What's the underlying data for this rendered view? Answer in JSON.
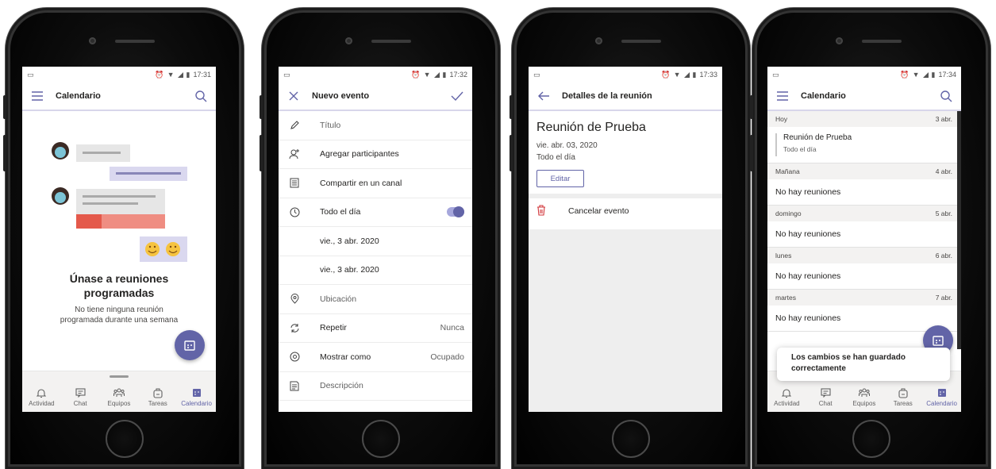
{
  "screens": [
    {
      "time": "17:31",
      "header": {
        "title": "Calendario"
      },
      "empty_state": {
        "title": "Únase a reuniones programadas",
        "subtitle": "No tiene ninguna reunión programada durante una semana"
      }
    },
    {
      "time": "17:32",
      "header": {
        "title": "Nuevo evento"
      },
      "form": [
        {
          "icon": "pencil-icon",
          "label": "Título",
          "value": "",
          "placeholder": true
        },
        {
          "icon": "add-person-icon",
          "label": "Agregar participantes",
          "value": ""
        },
        {
          "icon": "channel-icon",
          "label": "Compartir en un canal",
          "value": ""
        },
        {
          "icon": "clock-icon",
          "label": "Todo el día",
          "value": "",
          "toggle": true
        },
        {
          "icon": "",
          "label": "vie., 3 abr. 2020",
          "value": ""
        },
        {
          "icon": "",
          "label": "vie., 3 abr. 2020",
          "value": ""
        },
        {
          "icon": "location-icon",
          "label": "Ubicación",
          "value": "",
          "placeholder": true
        },
        {
          "icon": "repeat-icon",
          "label": "Repetir",
          "value": "Nunca"
        },
        {
          "icon": "eye-icon",
          "label": "Mostrar como",
          "value": "Ocupado"
        },
        {
          "icon": "description-icon",
          "label": "Descripción",
          "value": "",
          "placeholder": true
        }
      ]
    },
    {
      "time": "17:33",
      "header": {
        "title": "Detalles de la reunión"
      },
      "meeting": {
        "title": "Reunión de Prueba",
        "date": "vie. abr. 03, 2020",
        "duration": "Todo el día",
        "edit_label": "Editar",
        "cancel_label": "Cancelar evento"
      }
    },
    {
      "time": "17:34",
      "header": {
        "title": "Calendario"
      },
      "agenda": [
        {
          "day": "Hoy",
          "date": "3 abr.",
          "meeting": {
            "title": "Reunión de Prueba",
            "sub": "Todo el día"
          }
        },
        {
          "day": "Mañana",
          "date": "4 abr.",
          "empty": "No hay reuniones"
        },
        {
          "day": "domingo",
          "date": "5 abr.",
          "empty": "No hay reuniones"
        },
        {
          "day": "lunes",
          "date": "6 abr.",
          "empty": "No hay reuniones"
        },
        {
          "day": "martes",
          "date": "7 abr.",
          "empty": "No hay reuniones"
        }
      ],
      "toast": "Los cambios se han guardado correctamente"
    }
  ],
  "tabs": [
    {
      "label": "Actividad",
      "icon": "bell-icon"
    },
    {
      "label": "Chat",
      "icon": "chat-icon"
    },
    {
      "label": "Equipos",
      "icon": "teams-icon"
    },
    {
      "label": "Tareas",
      "icon": "tasks-icon"
    },
    {
      "label": "Calendario",
      "icon": "calendar-icon",
      "active": true
    }
  ],
  "colors": {
    "accent": "#6264a7",
    "accent_light": "#a6a7dc",
    "danger": "#d13438"
  }
}
